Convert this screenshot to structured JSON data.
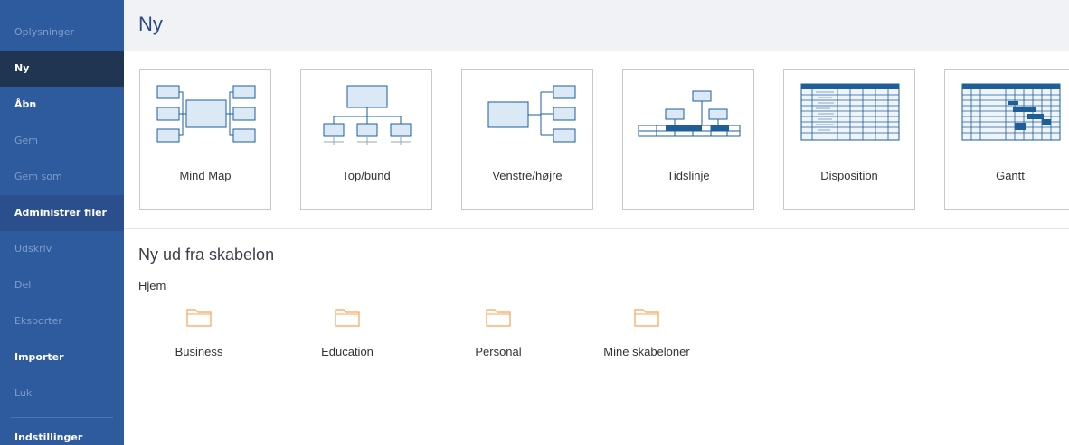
{
  "sidebar": {
    "items": [
      {
        "label": "Oplysninger",
        "state": "disabled"
      },
      {
        "label": "Ny",
        "state": "selected"
      },
      {
        "label": "Åbn",
        "state": "enabled"
      },
      {
        "label": "Gem",
        "state": "disabled"
      },
      {
        "label": "Gem som",
        "state": "disabled"
      },
      {
        "label": "Administrer filer",
        "state": "hover"
      },
      {
        "label": "Udskriv",
        "state": "disabled"
      },
      {
        "label": "Del",
        "state": "disabled"
      },
      {
        "label": "Eksporter",
        "state": "disabled"
      },
      {
        "label": "Importer",
        "state": "enabled"
      },
      {
        "label": "Luk",
        "state": "disabled"
      },
      {
        "label": "Indstillinger",
        "state": "enabled"
      }
    ]
  },
  "header": {
    "title": "Ny"
  },
  "templates": [
    {
      "label": "Mind Map",
      "icon": "mind-map-icon"
    },
    {
      "label": "Top/bund",
      "icon": "top-bottom-icon"
    },
    {
      "label": "Venstre/højre",
      "icon": "left-right-icon"
    },
    {
      "label": "Tidslinje",
      "icon": "timeline-icon"
    },
    {
      "label": "Disposition",
      "icon": "outline-icon"
    },
    {
      "label": "Gantt",
      "icon": "gantt-icon"
    }
  ],
  "from_template": {
    "title": "Ny ud fra skabelon",
    "breadcrumb": "Hjem",
    "folders": [
      {
        "label": "Business"
      },
      {
        "label": "Education"
      },
      {
        "label": "Personal"
      },
      {
        "label": "Mine skabeloner"
      }
    ]
  },
  "colors": {
    "sidebar_bg": "#2e5b9e",
    "sidebar_selected": "#1f3552",
    "header_bg": "#f1f2f5",
    "accent": "#2a4c86",
    "folder": "#f5a55a",
    "diagram_stroke": "#1e5f99",
    "diagram_fill": "#dbe9f6"
  }
}
